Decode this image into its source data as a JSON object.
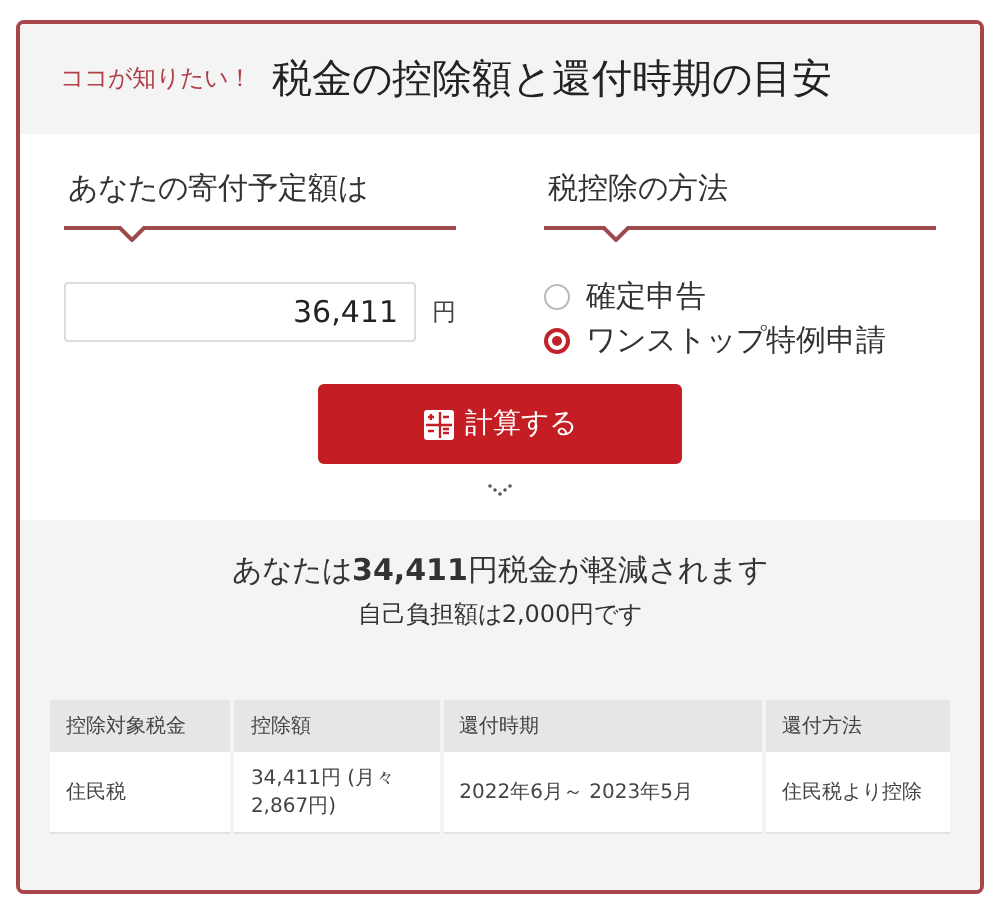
{
  "header": {
    "tagline": "ココが知りたい！",
    "title": "税金の控除額と還付時期の目安"
  },
  "donation": {
    "label": "あなたの寄付予定額は",
    "value": "36,411",
    "unit": "円"
  },
  "method": {
    "label": "税控除の方法",
    "options": [
      {
        "label": "確定申告",
        "selected": false
      },
      {
        "label": "ワンストップ特例申請",
        "selected": true
      }
    ]
  },
  "calculate_button": "計算する",
  "result": {
    "headline": "あなたは**34,411**円税金が軽減されます",
    "subline": "自己負担額は2,000円です"
  },
  "table": {
    "columns": [
      "控除対象税金",
      "控除額",
      "還付時期",
      "還付方法"
    ],
    "rows": [
      [
        "住民税",
        "34,411円 (月々 2,867円)",
        "2022年6月～ 2023年5月",
        "住民税より控除"
      ]
    ]
  }
}
